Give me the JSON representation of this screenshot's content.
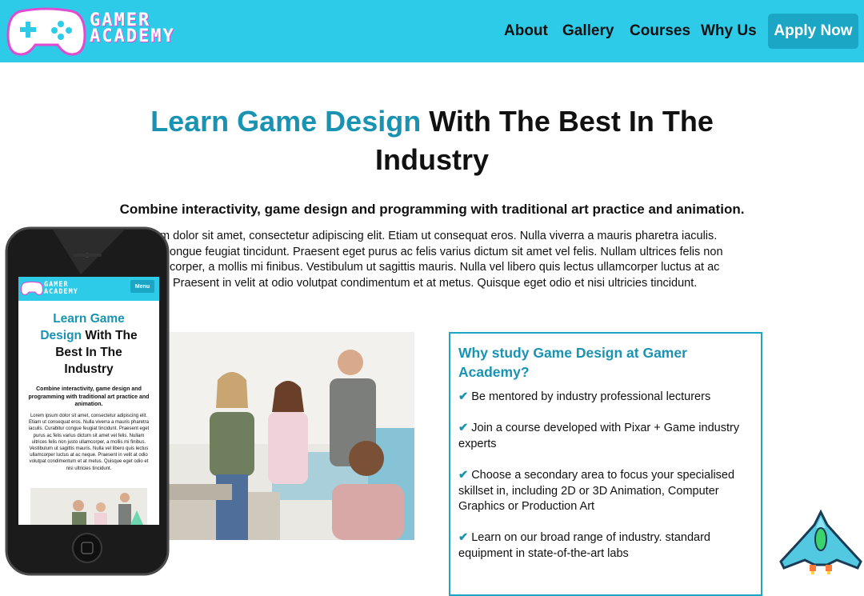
{
  "header": {
    "logo_line1": "GAMER",
    "logo_line2": "ACADEMY",
    "nav": [
      "About",
      "Gallery",
      "Courses",
      "Why Us"
    ],
    "apply_label": "Apply Now"
  },
  "hero": {
    "title_accent": "Learn Game Design",
    "title_rest_1": " With The Best In The",
    "title_rest_2": "Industry",
    "subheading": "Combine interactivity, game design and programming with traditional art practice and animation.",
    "paragraph_lines": [
      "m dolor sit amet, consectetur adipiscing elit. Etiam ut consequat eros. Nulla viverra a mauris pharetra iaculis.",
      "ongue feugiat tincidunt. Praesent eget purus ac felis varius dictum sit amet vel felis. Nullam ultrices felis non",
      "corper, a mollis mi finibus. Vestibulum ut sagittis mauris. Nulla vel libero quis lectus ullamcorper luctus at ac",
      "Praesent in velit at odio volutpat condimentum et at metus. Quisque eget odio et nisi ultricies tincidunt."
    ]
  },
  "why": {
    "title": "Why study Game Design at Gamer Academy?",
    "items": [
      "Be mentored by industry professional lecturers",
      "Join a course developed with Pixar + Game industry experts",
      "Choose a secondary area to focus your specialised skillset in, including 2D or 3D Animation, Computer Graphics or Production Art",
      "Learn on our broad range of industry. standard equipment in state-of-the-art labs"
    ]
  },
  "phone": {
    "logo_line1": "GAMER",
    "logo_line2": "ACADEMY",
    "menu_label": "Menu",
    "title_accent_1": "Learn Game",
    "title_accent_2": "Design",
    "title_rest_1": " With The",
    "title_rest_2": "Best In The",
    "title_rest_3": "Industry",
    "subheading": "Combine interactivity, game design and programming with traditional art practice and animation.",
    "paragraph": "Lorem ipsum dolor sit amet, consectetur adipiscing elit. Etiam ut consequat eros. Nulla viverra a mauris pharetra iaculis. Curabitur congue feugiat tincidunt. Praesent eget purus ac felis varius dictum sit amet vel felis. Nullam ultrices felis non justo ullamcorper, a mollis mi finibus. Vestibulum ut sagittis mauris. Nulla vel libero quis lectus ullamcorper luctus at ac neque. Praesent in velit at odio volutpat condimentum et at metus. Quisque eget odio et nisi ultricies tincidunt."
  },
  "colors": {
    "header_bg": "#2dcbe8",
    "accent": "#1a93b2",
    "button_bg": "#1aa6c4"
  },
  "icons": [
    "gamepad-logo-icon",
    "check-icon",
    "pixel-spaceship-icon"
  ]
}
